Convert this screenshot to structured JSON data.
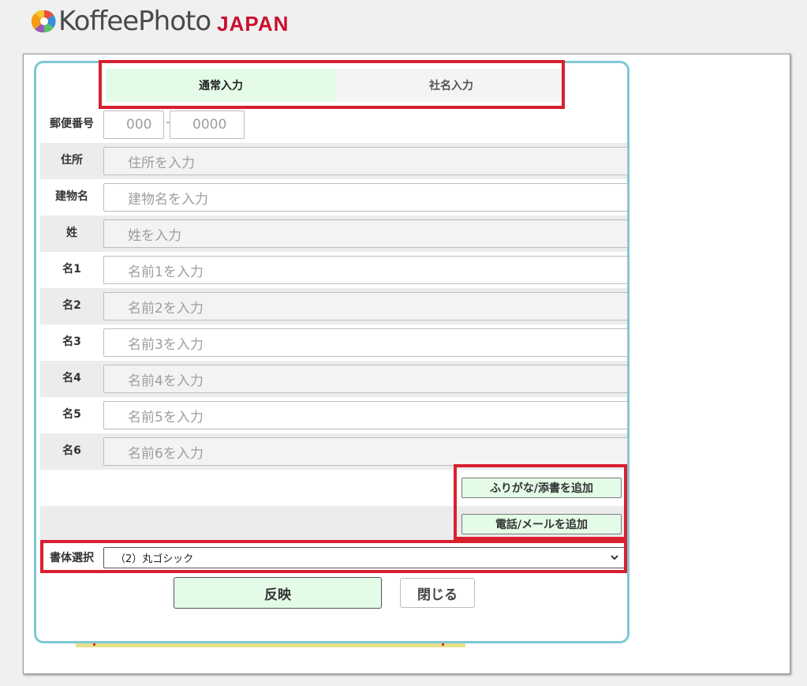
{
  "brand": {
    "wordmark": "KoffeePhoto",
    "region": "JAPAN"
  },
  "tabs": [
    {
      "label": "通常入力",
      "active": true
    },
    {
      "label": "社名入力",
      "active": false
    }
  ],
  "form": {
    "postal": {
      "label": "郵便番号",
      "placeholder1": "000",
      "placeholder2": "0000"
    },
    "fields": [
      {
        "label": "住所",
        "placeholder": "住所を入力"
      },
      {
        "label": "建物名",
        "placeholder": "建物名を入力"
      },
      {
        "label": "姓",
        "placeholder": "姓を入力"
      },
      {
        "label": "名1",
        "placeholder": "名前1を入力"
      },
      {
        "label": "名2",
        "placeholder": "名前2を入力"
      },
      {
        "label": "名3",
        "placeholder": "名前3を入力"
      },
      {
        "label": "名4",
        "placeholder": "名前4を入力"
      },
      {
        "label": "名5",
        "placeholder": "名前5を入力"
      },
      {
        "label": "名6",
        "placeholder": "名前6を入力"
      }
    ],
    "add_furigana_label": "ふりがな/添書を追加",
    "add_contact_label": "電話/メールを追加",
    "font_select": {
      "label": "書体選択",
      "value": "（2）丸ゴシック"
    }
  },
  "actions": {
    "apply_label": "反映",
    "close_label": "閉じる"
  },
  "colors": {
    "accent_green": "#e4fbe8",
    "modal_border": "#7ec8d6",
    "highlight_red": "#d8202f",
    "brand_red": "#c8102e"
  }
}
